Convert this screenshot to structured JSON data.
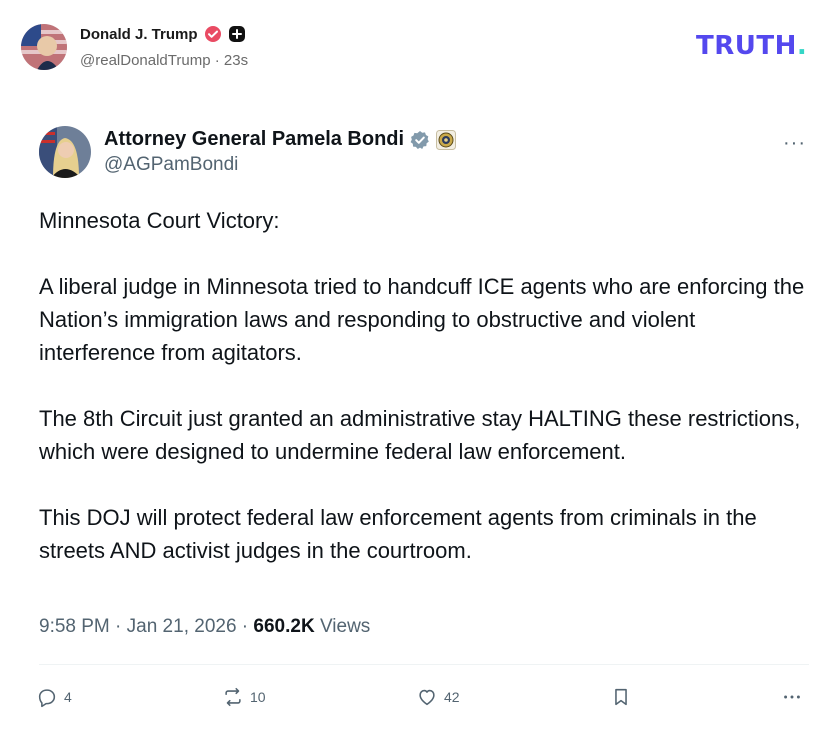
{
  "truth_header": {
    "display_name": "Donald J. Trump",
    "handle_line": "@realDonaldTrump · 23s",
    "logo_text": "TRUTH",
    "logo_dot": ".",
    "verified_color": "#e94b63",
    "brand_color": "#5448ee",
    "accent_color": "#35d6c6"
  },
  "post": {
    "author_name": "Attorney General Pamela Bondi",
    "author_handle": "@AGPamBondi",
    "more_label": "···",
    "paragraphs": [
      "Minnesota Court Victory:",
      "A liberal judge in Minnesota tried to handcuff ICE agents who are enforcing the Nation’s immigration laws and responding to obstructive and violent interference from agitators.",
      "The 8th Circuit just granted an administrative stay HALTING these restrictions, which were designed to undermine federal law enforcement.",
      "This DOJ will protect federal law enforcement agents from criminals in the streets AND activist judges in the courtroom."
    ],
    "timestamp": "9:58 PM · Jan 21, 2026 · ",
    "views_count": "660.2K",
    "views_label": "Views",
    "actions": {
      "replies": "4",
      "reposts": "10",
      "likes": "42"
    }
  }
}
